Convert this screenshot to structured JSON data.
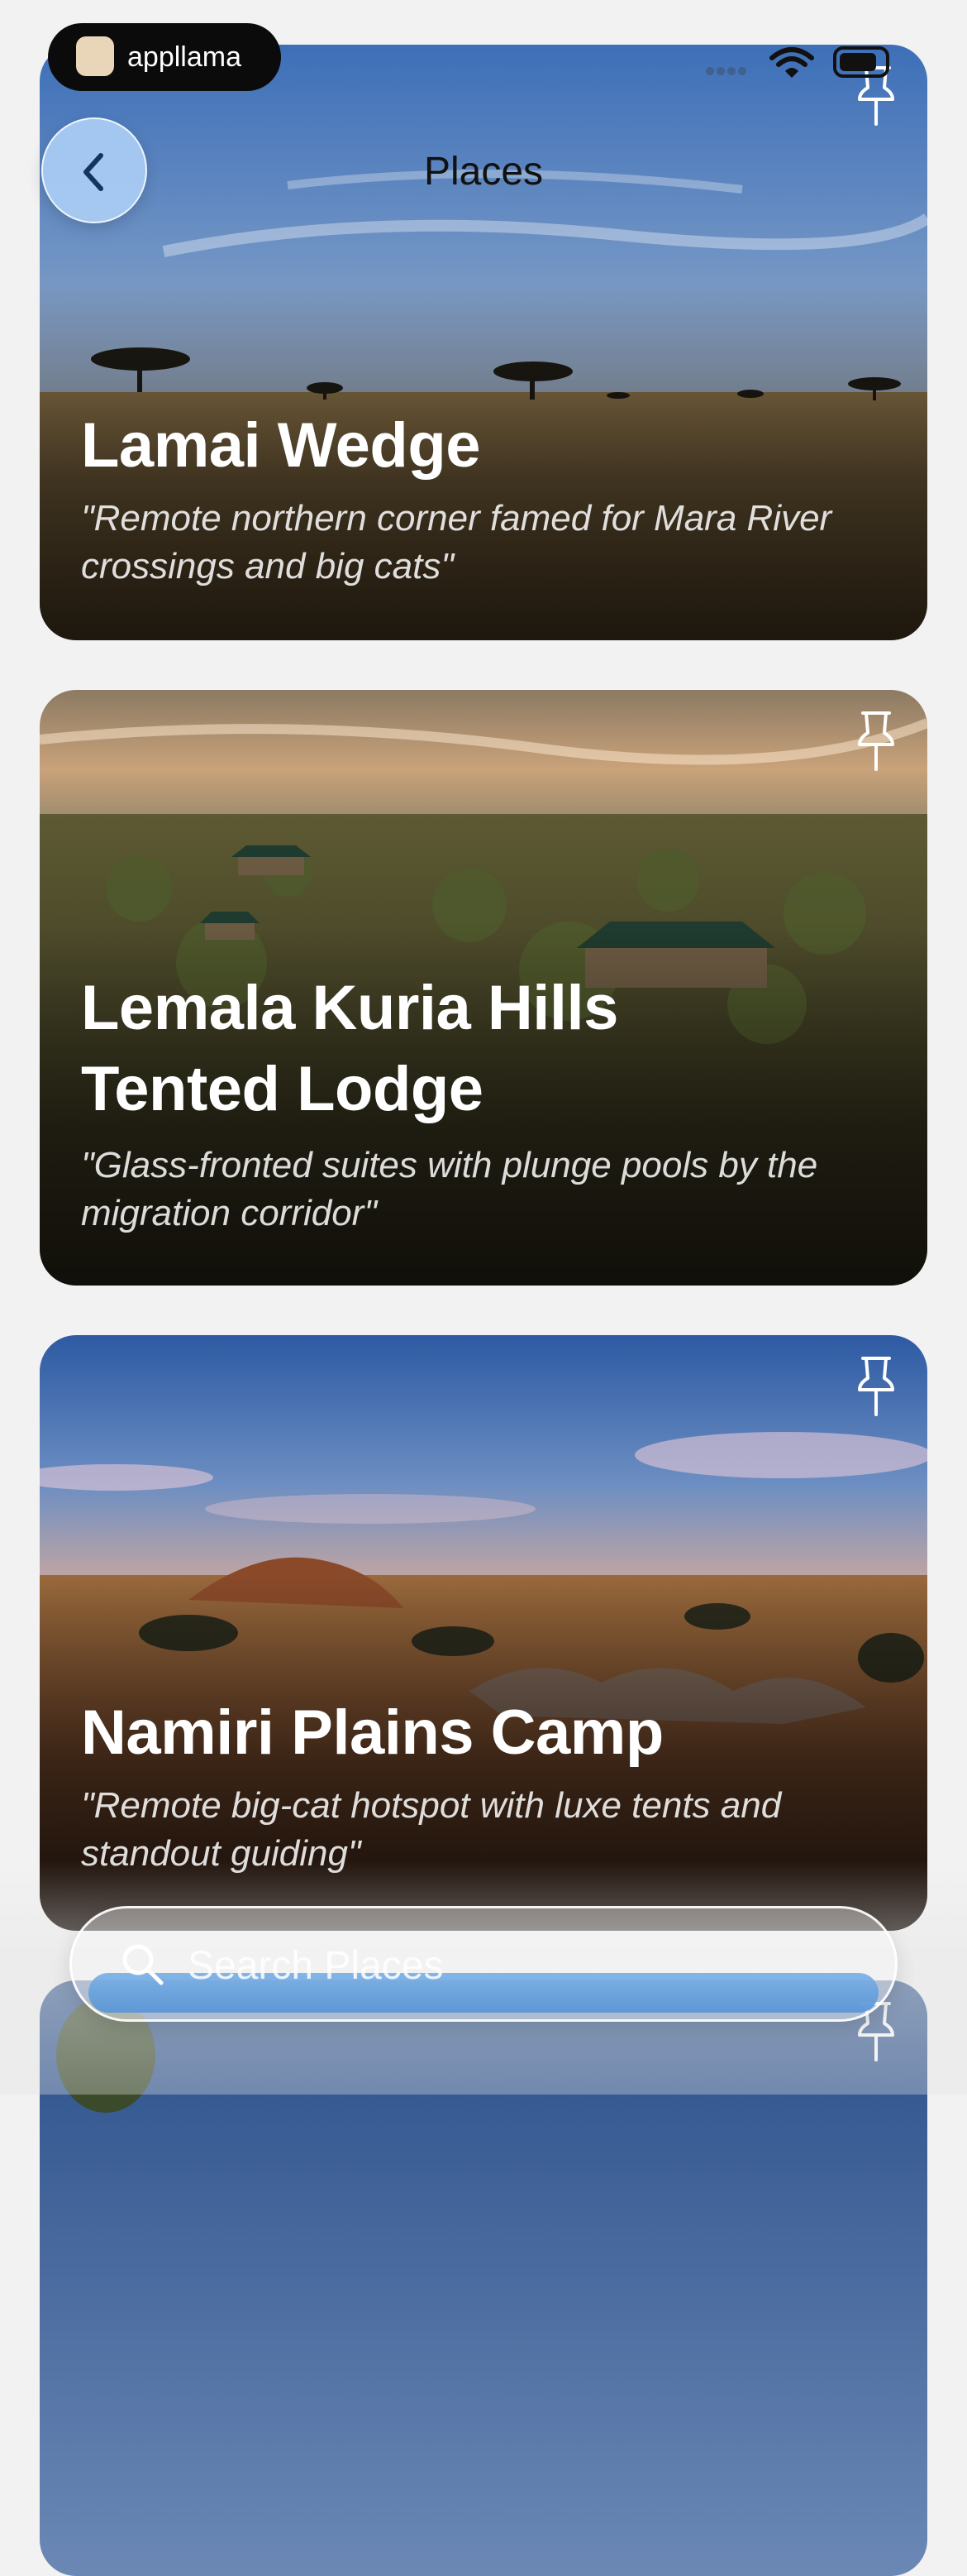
{
  "status_bar": {
    "app_badge": "appllama",
    "icons": [
      "llama-logo-icon",
      "signal-dots-icon",
      "wifi-icon",
      "battery-icon"
    ]
  },
  "nav": {
    "title": "Places",
    "back_icon": "chevron-left-icon"
  },
  "places": [
    {
      "title": "Lamai Wedge",
      "description": "\"Remote northern corner famed for Mara River crossings and big cats\"",
      "pin_icon": "pin-icon"
    },
    {
      "title": "Lemala Kuria Hills Tented Lodge",
      "description": "\"Glass-fronted suites with plunge pools by the migration corridor\"",
      "pin_icon": "pin-icon"
    },
    {
      "title": "Namiri Plains Camp",
      "description": "\"Remote big-cat hotspot with luxe tents and standout guiding\"",
      "pin_icon": "pin-icon"
    }
  ],
  "search": {
    "placeholder": "Search Places",
    "value": "",
    "icon": "search-icon"
  }
}
